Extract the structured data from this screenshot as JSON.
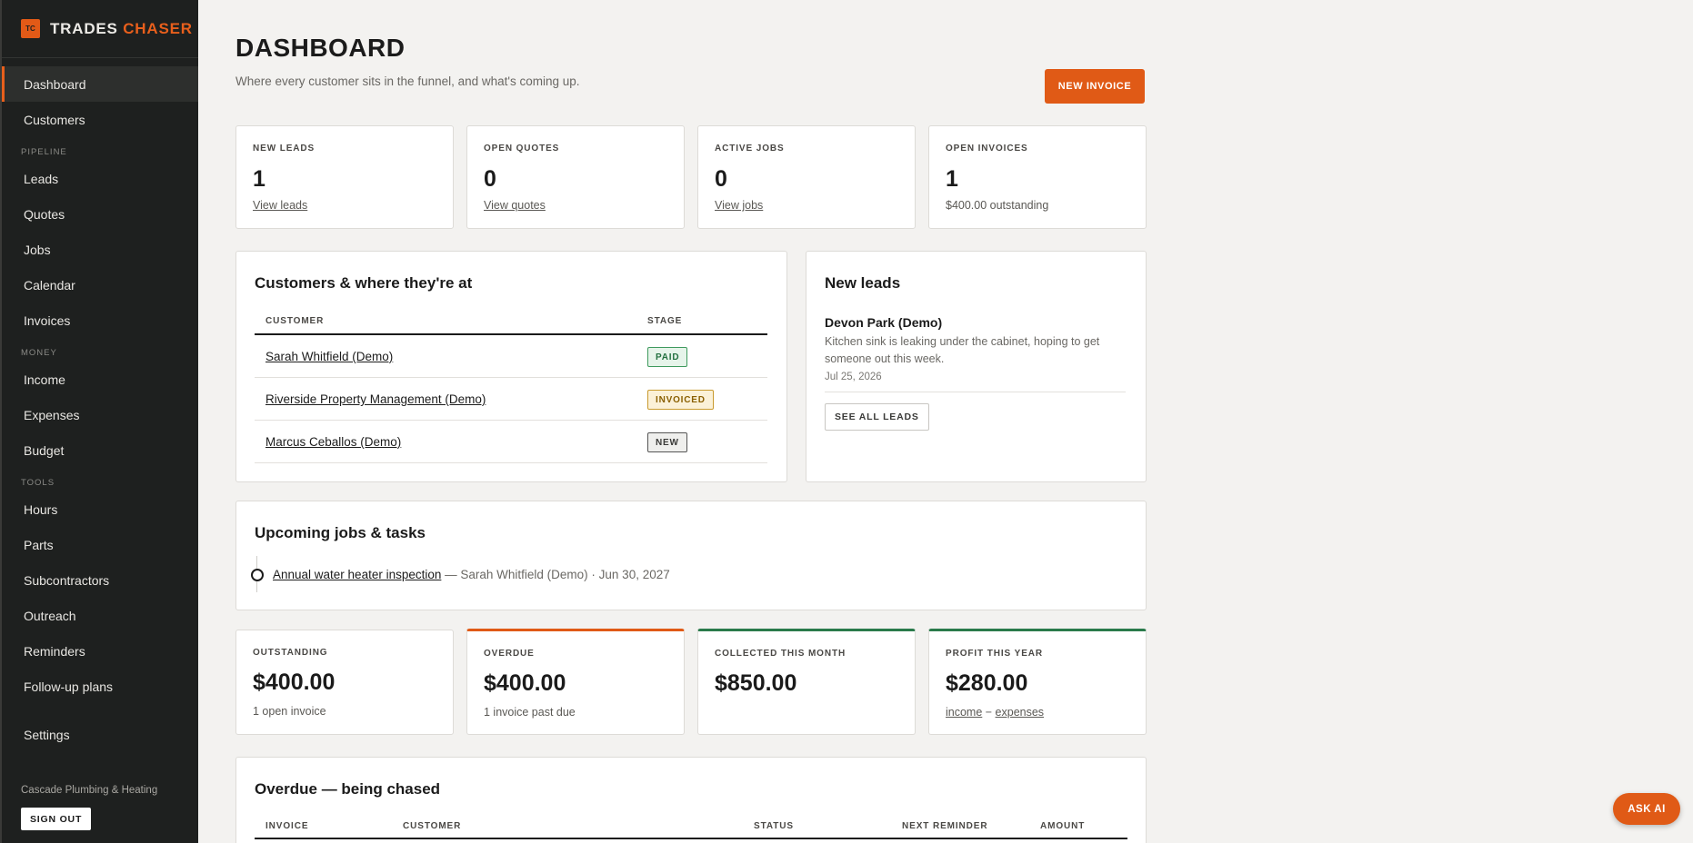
{
  "brand": {
    "logo_text": "TC",
    "name_first": "TRADES",
    "name_second": "CHASER",
    "accent_color": "#e85f1c"
  },
  "nav": {
    "dashboard": "Dashboard",
    "customers": "Customers",
    "section_pipeline": "PIPELINE",
    "leads": "Leads",
    "quotes": "Quotes",
    "jobs": "Jobs",
    "calendar": "Calendar",
    "invoices": "Invoices",
    "section_money": "MONEY",
    "income": "Income",
    "expenses": "Expenses",
    "budget": "Budget",
    "section_tools": "TOOLS",
    "hours": "Hours",
    "parts": "Parts",
    "subcontractors": "Subcontractors",
    "outreach": "Outreach",
    "reminders": "Reminders",
    "followup": "Follow-up plans",
    "settings": "Settings"
  },
  "org_name": "Cascade Plumbing & Heating",
  "sign_out": "SIGN OUT",
  "header": {
    "title": "DASHBOARD",
    "subtitle": "Where every customer sits in the funnel, and what's coming up.",
    "new_invoice": "NEW INVOICE"
  },
  "stats": [
    {
      "label": "NEW LEADS",
      "value": "1",
      "link": "View leads"
    },
    {
      "label": "OPEN QUOTES",
      "value": "0",
      "link": "View quotes"
    },
    {
      "label": "ACTIVE JOBS",
      "value": "0",
      "link": "View jobs"
    },
    {
      "label": "OPEN INVOICES",
      "value": "1",
      "sub": "$400.00 outstanding"
    }
  ],
  "customers_card": {
    "title": "Customers & where they're at",
    "col_customer": "CUSTOMER",
    "col_stage": "STAGE",
    "rows": [
      {
        "name": "Sarah Whitfield (Demo)",
        "stage": "PAID"
      },
      {
        "name": "Riverside Property Management (Demo)",
        "stage": "INVOICED"
      },
      {
        "name": "Marcus Ceballos (Demo)",
        "stage": "NEW"
      }
    ]
  },
  "leads_card": {
    "title": "New leads",
    "lead_name": "Devon Park (Demo)",
    "lead_desc": "Kitchen sink is leaking under the cabinet, hoping to get someone out this week.",
    "lead_date": "Jul 25, 2026",
    "see_all": "SEE ALL LEADS"
  },
  "upcoming": {
    "title": "Upcoming jobs & tasks",
    "task": "Annual water heater inspection",
    "task_meta": " — Sarah Whitfield (Demo) · Jun 30, 2027"
  },
  "money": [
    {
      "label": "OUTSTANDING",
      "value": "$400.00",
      "sub": "1 open invoice"
    },
    {
      "label": "OVERDUE",
      "value": "$400.00",
      "sub": "1 invoice past due"
    },
    {
      "label": "COLLECTED THIS MONTH",
      "value": "$850.00"
    },
    {
      "label": "PROFIT THIS YEAR",
      "value": "$280.00",
      "sub_income": "income",
      "sub_sep": " − ",
      "sub_expenses": "expenses"
    }
  ],
  "overdue": {
    "title": "Overdue — being chased",
    "col_invoice": "INVOICE",
    "col_customer": "CUSTOMER",
    "col_status": "STATUS",
    "col_next": "NEXT REMINDER",
    "col_amount": "AMOUNT"
  },
  "ask_ai": "ASK AI"
}
